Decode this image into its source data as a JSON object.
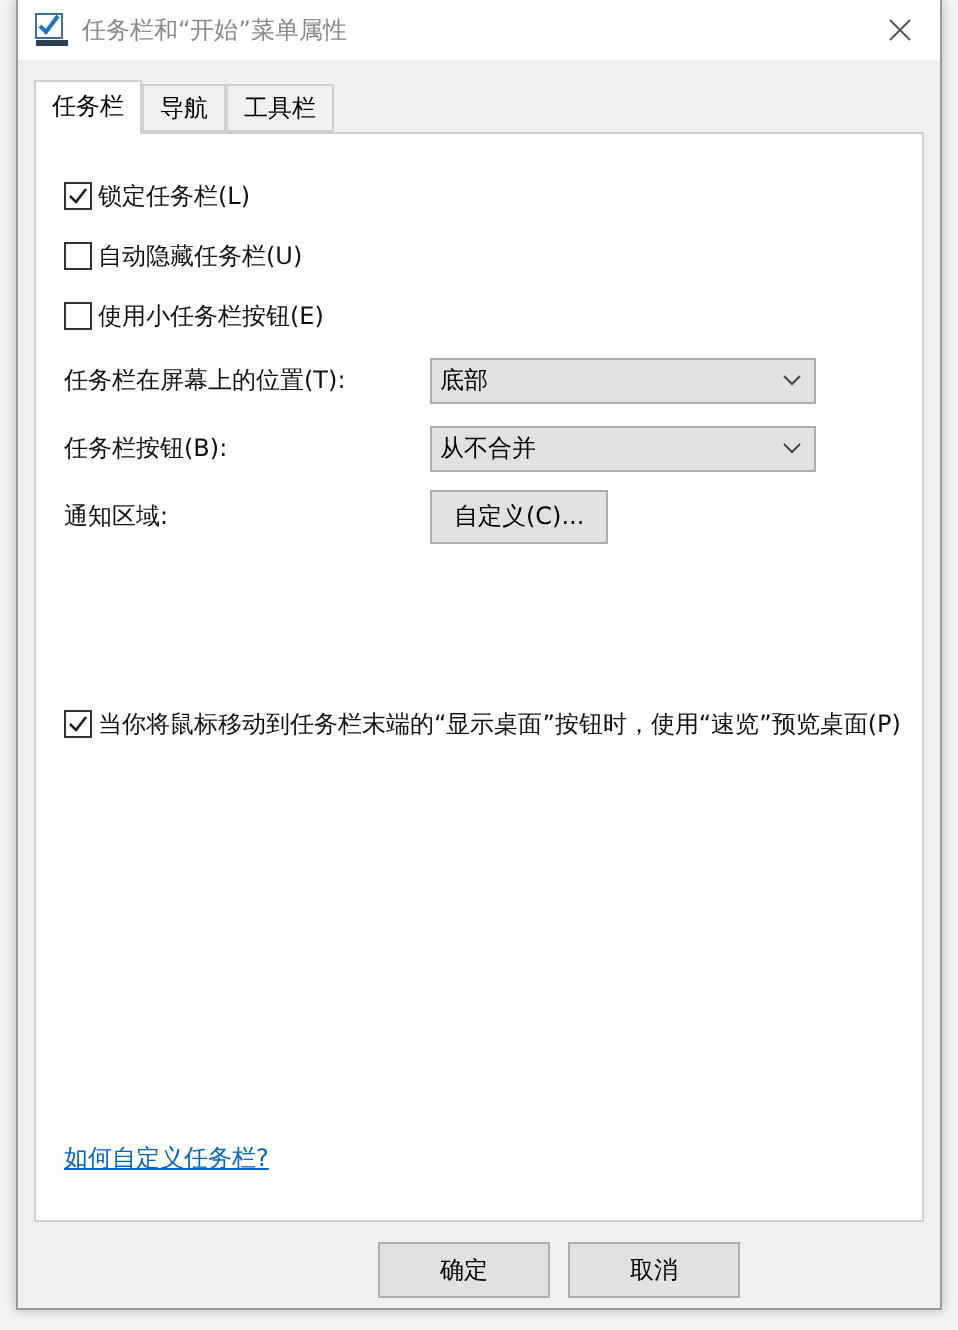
{
  "window": {
    "title": "任务栏和“开始”菜单属性"
  },
  "tabs": [
    {
      "label": "任务栏",
      "selected": true
    },
    {
      "label": "导航",
      "selected": false
    },
    {
      "label": "工具栏",
      "selected": false
    }
  ],
  "options": [
    {
      "label": "锁定任务栏(L)",
      "checked": true
    },
    {
      "label": "自动隐藏任务栏(U)",
      "checked": false
    },
    {
      "label": "使用小任务栏按钮(E)",
      "checked": false
    }
  ],
  "settings": [
    {
      "kind": "dropdown",
      "label": "任务栏在屏幕上的位置(T):",
      "value": "底部"
    },
    {
      "kind": "dropdown",
      "label": "任务栏按钮(B):",
      "value": "从不合并"
    },
    {
      "kind": "button",
      "label": "通知区域:",
      "value": "自定义(C)..."
    }
  ],
  "peek": {
    "label": "当你将鼠标移动到任务栏末端的“显示桌面”按钮时，使用“速览”预览桌面(P)",
    "checked": true
  },
  "help_link": "如何自定义任务栏?",
  "buttons": [
    "确定",
    "取消"
  ]
}
